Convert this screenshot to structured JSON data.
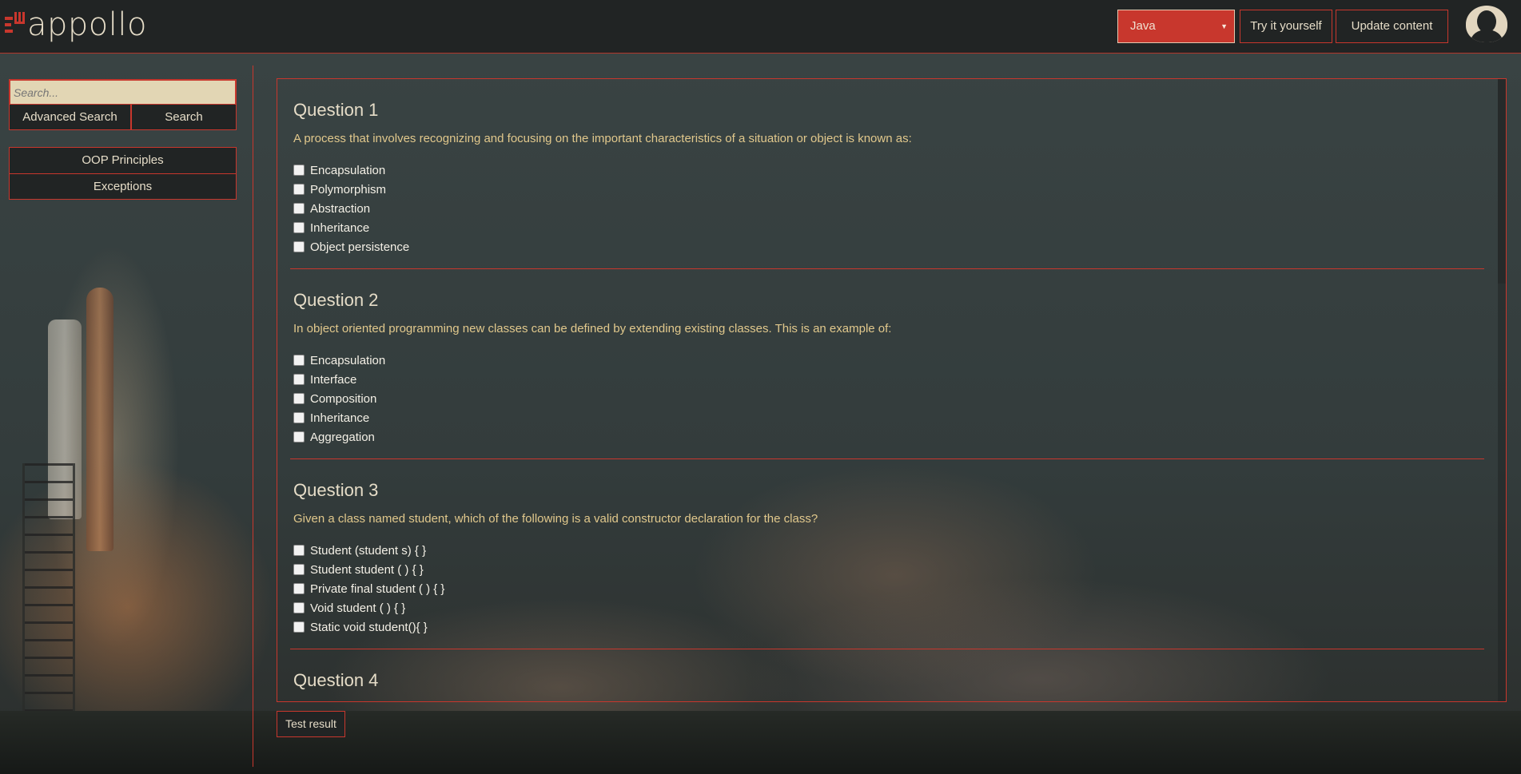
{
  "header": {
    "logo_text": "appollo",
    "language_select": {
      "value": "Java"
    },
    "try_button": "Try it yourself",
    "update_button": "Update content"
  },
  "sidebar": {
    "search_placeholder": "Search...",
    "advanced_search_button": "Advanced Search",
    "search_button": "Search",
    "categories": [
      "OOP Principles",
      "Exceptions"
    ]
  },
  "quiz": {
    "questions": [
      {
        "title": "Question 1",
        "text": "A process that involves recognizing and focusing on the important characteristics of a situation or object is known as:",
        "options": [
          "Encapsulation",
          "Polymorphism",
          "Abstraction",
          "Inheritance",
          "Object persistence"
        ]
      },
      {
        "title": "Question 2",
        "text": "In object oriented programming new classes can be defined by extending existing classes. This is an example of:",
        "options": [
          "Encapsulation",
          "Interface",
          "Composition",
          "Inheritance",
          "Aggregation"
        ]
      },
      {
        "title": "Question 3",
        "text": "Given a class named student, which of the following is a valid constructor declaration for the class?",
        "options": [
          "Student (student s) { }",
          "Student student ( ) { }",
          "Private final student ( ) { }",
          "Void student ( ) { }",
          "Static void student(){ }"
        ]
      },
      {
        "title": "Question 4"
      }
    ],
    "test_result_button": "Test result"
  },
  "colors": {
    "accent": "#c8372d",
    "header_bg": "#212424",
    "text_light": "#e6ddc8",
    "question_text": "#e1c88c",
    "search_bg": "#e2d6b4"
  }
}
